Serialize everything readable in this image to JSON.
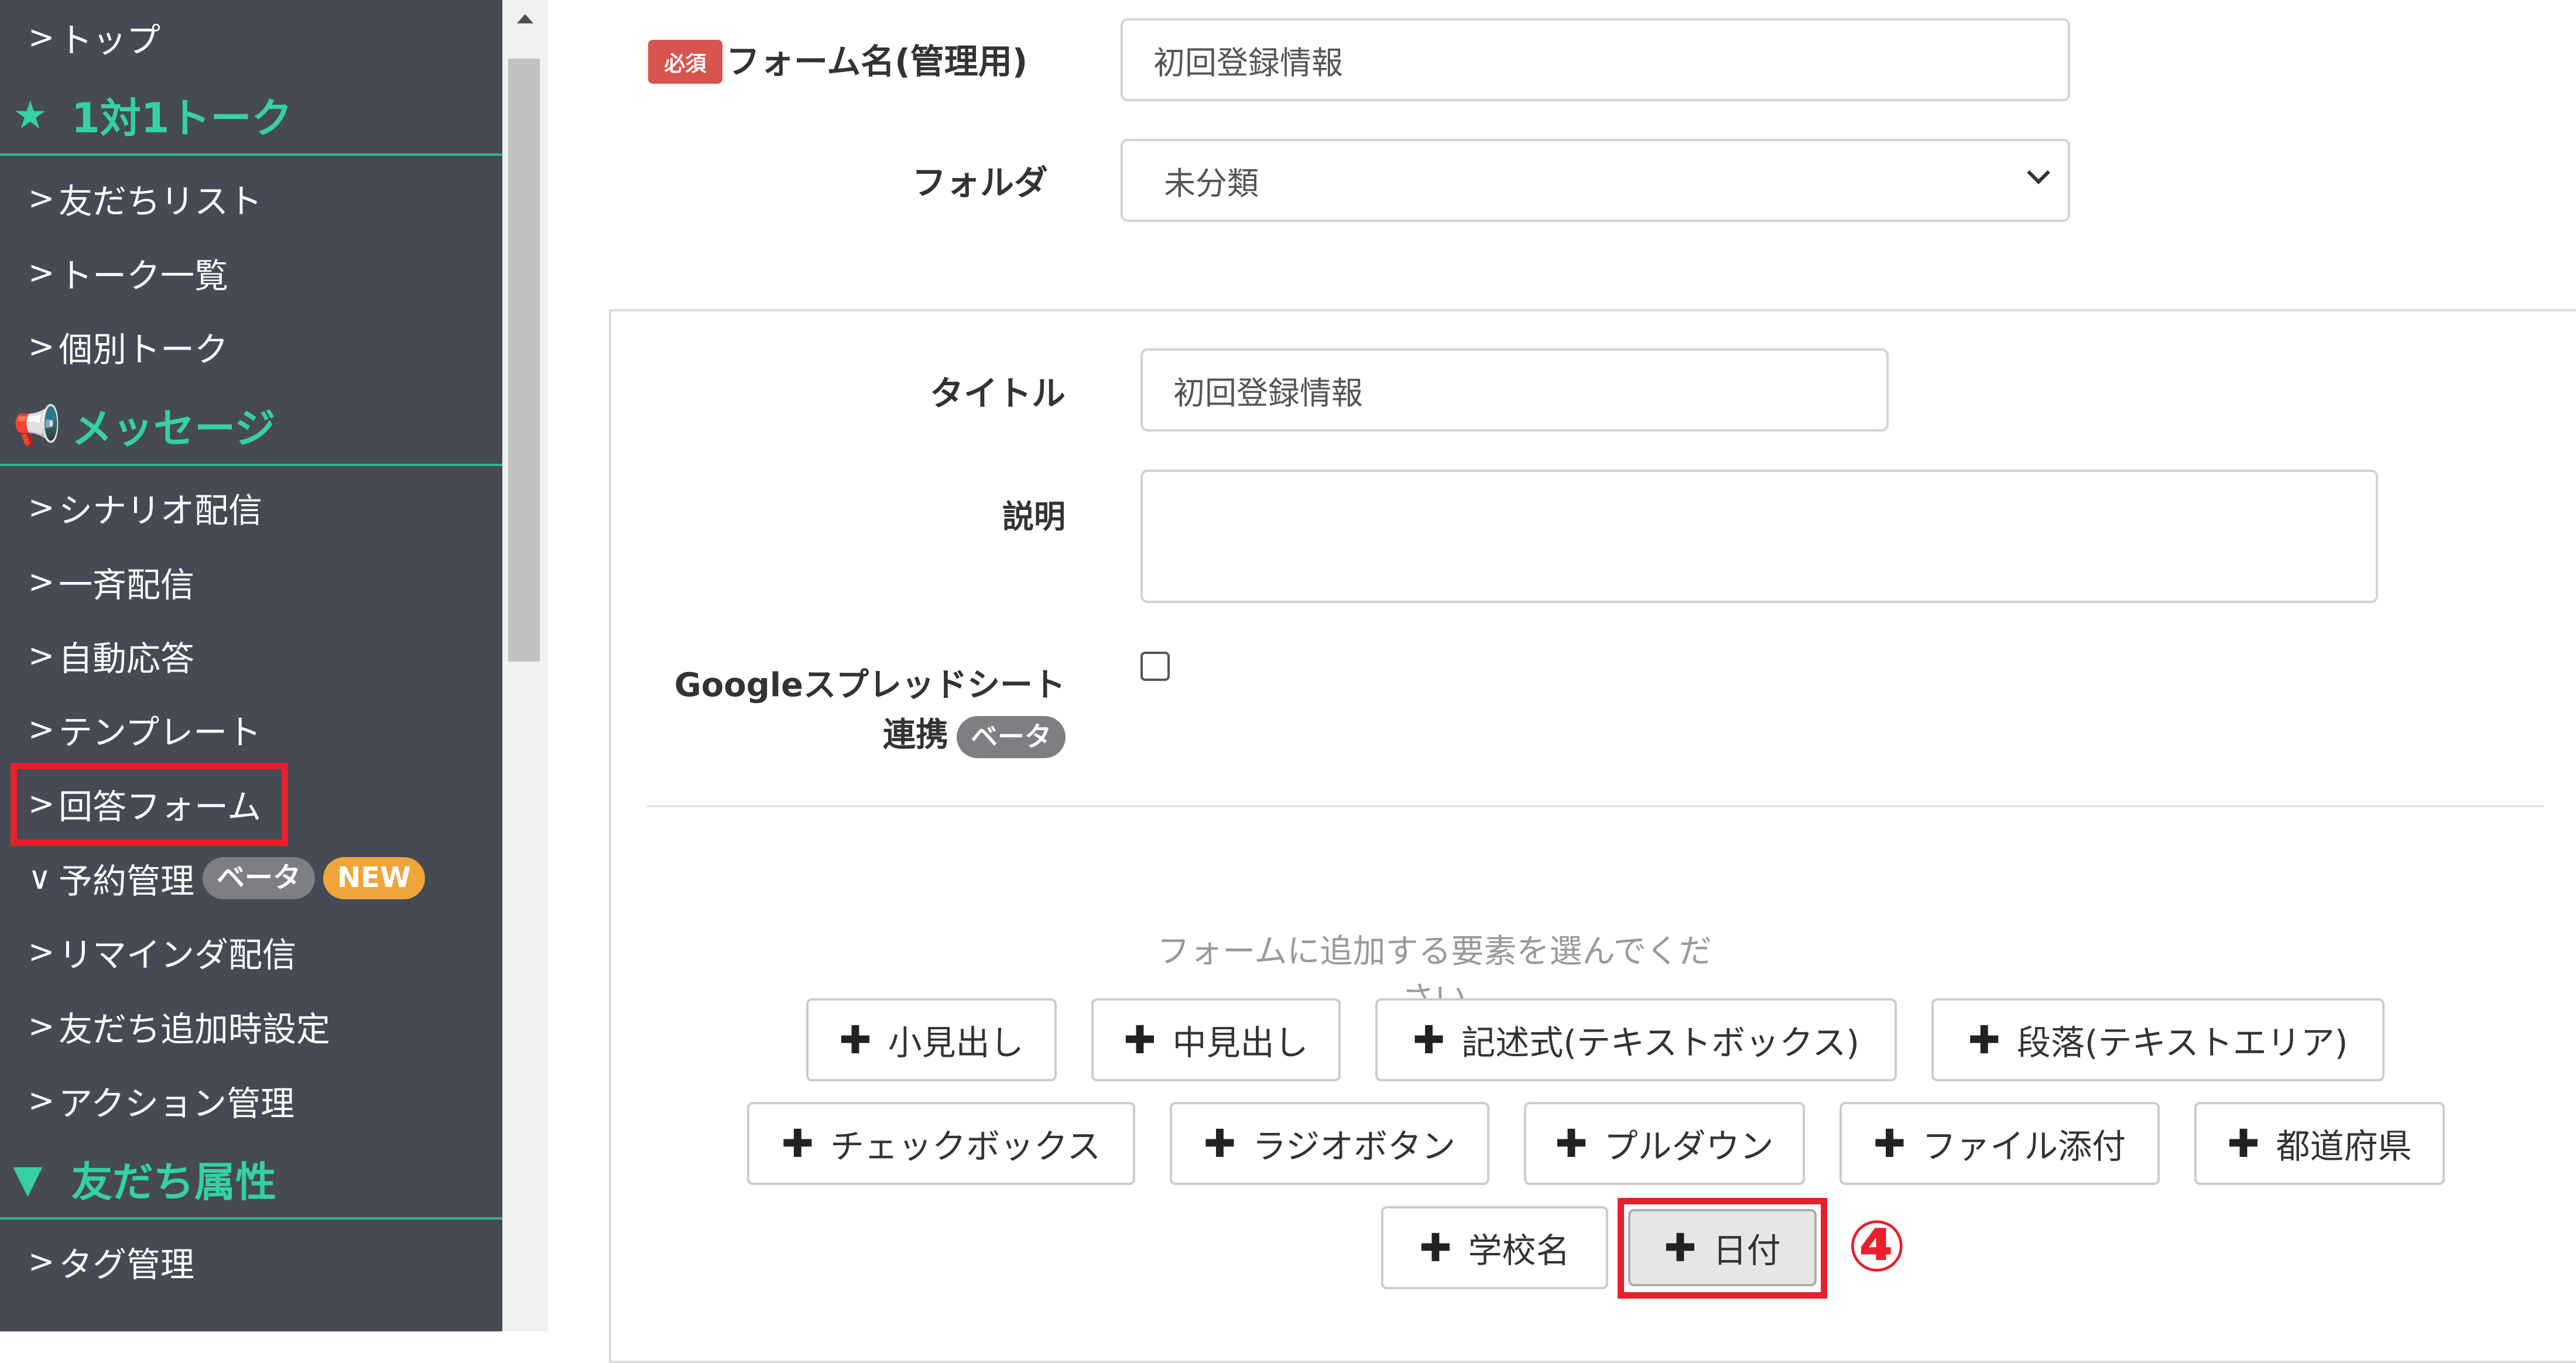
{
  "sidebar": {
    "items": [
      {
        "label": "トップ",
        "marker": ">"
      },
      {
        "label": "1対1トーク",
        "icon": "star-icon",
        "glyph": "★",
        "section": true
      },
      {
        "label": "友だちリスト",
        "marker": ">"
      },
      {
        "label": "トーク一覧",
        "marker": ">"
      },
      {
        "label": "個別トーク",
        "marker": ">"
      },
      {
        "label": "メッセージ",
        "icon": "megaphone-icon",
        "glyph": "📢",
        "section": true
      },
      {
        "label": "シナリオ配信",
        "marker": ">"
      },
      {
        "label": "一斉配信",
        "marker": ">"
      },
      {
        "label": "自動応答",
        "marker": ">"
      },
      {
        "label": "テンプレート",
        "marker": ">"
      },
      {
        "label": "回答フォーム",
        "marker": ">",
        "highlighted": true
      },
      {
        "label": "予約管理",
        "marker": "∨",
        "badge_beta": "ベータ",
        "badge_new": "NEW"
      },
      {
        "label": "リマインダ配信",
        "marker": ">"
      },
      {
        "label": "友だち追加時設定",
        "marker": ">"
      },
      {
        "label": "アクション管理",
        "marker": ">"
      },
      {
        "label": "友だち属性",
        "icon": "filter-icon",
        "glyph": "▼",
        "section": true
      },
      {
        "label": "タグ管理",
        "marker": ">"
      }
    ],
    "colors": {
      "background": "#464a55",
      "section_text": "#35d0a5",
      "highlight": "#e8202c"
    }
  },
  "form": {
    "form_name": {
      "label": "フォーム名(管理用)",
      "required_badge": "必須",
      "value": "初回登録情報"
    },
    "folder": {
      "label": "フォルダ",
      "selected": "未分類"
    },
    "title": {
      "label": "タイトル",
      "value": "初回登録情報"
    },
    "description": {
      "label": "説明",
      "value": ""
    },
    "google_sheets": {
      "label_line1": "Googleスプレッドシート",
      "label_line2": "連携",
      "badge": "ベータ",
      "checked": false
    }
  },
  "elements": {
    "hint": "フォームに追加する要素を選んでください",
    "plus_glyph": "✚",
    "buttons": [
      {
        "label": "小見出し"
      },
      {
        "label": "中見出し"
      },
      {
        "label": "記述式(テキストボックス)"
      },
      {
        "label": "段落(テキストエリア)"
      },
      {
        "label": "チェックボックス"
      },
      {
        "label": "ラジオボタン"
      },
      {
        "label": "プルダウン"
      },
      {
        "label": "ファイル添付"
      },
      {
        "label": "都道府県"
      },
      {
        "label": "学校名"
      },
      {
        "label": "日付",
        "active": true,
        "highlighted": true
      }
    ]
  },
  "annotation": {
    "step": "④"
  }
}
